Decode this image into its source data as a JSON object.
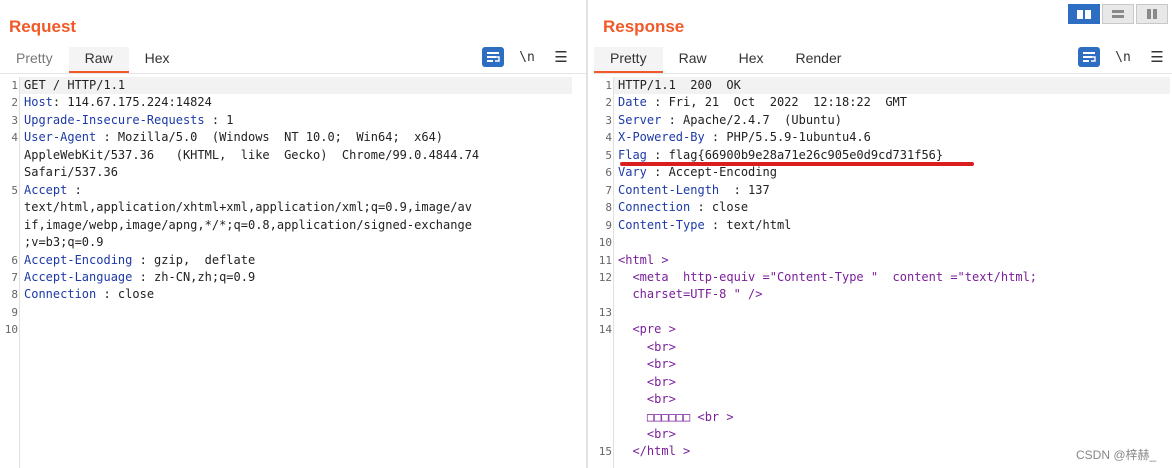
{
  "request": {
    "title": "Request",
    "tabs": [
      {
        "label": "Pretty"
      },
      {
        "label": "Raw"
      },
      {
        "label": "Hex"
      }
    ],
    "active_tab": "Raw",
    "tools": {
      "newline_label": "\\n",
      "menu_label": "☰"
    },
    "gutter": [
      "1",
      "2",
      "3",
      "4",
      "",
      "",
      "5",
      "",
      "",
      "",
      "6",
      "7",
      "8",
      "9",
      "10"
    ],
    "lines": [
      {
        "h": "",
        "v": "GET / HTTP/1.1"
      },
      {
        "h": "Host",
        "v": ": 114.67.175.224:14824"
      },
      {
        "h": "Upgrade-Insecure-Requests",
        "v": " : 1"
      },
      {
        "h": "User-Agent",
        "v": " : Mozilla/5.0  (Windows  NT 10.0;  Win64;  x64)"
      },
      {
        "h": "",
        "v": "AppleWebKit/537.36   (KHTML,  like  Gecko)  Chrome/99.0.4844.74"
      },
      {
        "h": "",
        "v": "Safari/537.36"
      },
      {
        "h": "Accept",
        "v": " :"
      },
      {
        "h": "",
        "v": "text/html,application/xhtml+xml,application/xml;q=0.9,image/av"
      },
      {
        "h": "",
        "v": "if,image/webp,image/apng,*/*;q=0.8,application/signed-exchange"
      },
      {
        "h": "",
        "v": ";v=b3;q=0.9"
      },
      {
        "h": "Accept-Encoding",
        "v": " : gzip,  deflate"
      },
      {
        "h": "Accept-Language",
        "v": " : zh-CN,zh;q=0.9"
      },
      {
        "h": "Connection",
        "v": " : close"
      },
      {
        "h": "",
        "v": ""
      },
      {
        "h": "",
        "v": ""
      }
    ]
  },
  "response": {
    "title": "Response",
    "tabs": [
      {
        "label": "Pretty"
      },
      {
        "label": "Raw"
      },
      {
        "label": "Hex"
      },
      {
        "label": "Render"
      }
    ],
    "active_tab": "Pretty",
    "tools": {
      "newline_label": "\\n",
      "menu_label": "☰"
    },
    "gutter": [
      "1",
      "2",
      "3",
      "4",
      "5",
      "6",
      "7",
      "8",
      "9",
      "10",
      "11",
      "12",
      "",
      "13",
      "14",
      "",
      "",
      "",
      "",
      "",
      "",
      "15"
    ],
    "lines": [
      {
        "h": "",
        "v": "HTTP/1.1  200  OK"
      },
      {
        "h": "Date",
        "v": " : Fri, 21  Oct  2022  12:18:22  GMT"
      },
      {
        "h": "Server",
        "v": " : Apache/2.4.7  (Ubuntu)"
      },
      {
        "h": "X-Powered-By",
        "v": " : PHP/5.5.9-1ubuntu4.6"
      },
      {
        "h": "Flag",
        "v": " : flag{66900b9e28a71e26c905e0d9cd731f56}"
      },
      {
        "h": "Vary",
        "v": " : Accept-Encoding"
      },
      {
        "h": "Content-Length",
        "v": "  : 137"
      },
      {
        "h": "Connection",
        "v": " : close"
      },
      {
        "h": "Content-Type",
        "v": " : text/html"
      },
      {
        "h": "",
        "v": ""
      },
      {
        "t": "<html >"
      },
      {
        "t": "  <meta  http-equiv =\"Content-Type \"  content =\"text/html;"
      },
      {
        "t": "  charset=UTF-8 \" />"
      },
      {
        "t": ""
      },
      {
        "t": "  <pre >"
      },
      {
        "t": "    <br>"
      },
      {
        "t": "    <br>"
      },
      {
        "t": "    <br>"
      },
      {
        "t": "    <br>"
      },
      {
        "t": "    □□□□□□ <br >"
      },
      {
        "t": "    <br>"
      },
      {
        "t": "  </html >"
      }
    ]
  },
  "watermark": "CSDN @梓赫_"
}
